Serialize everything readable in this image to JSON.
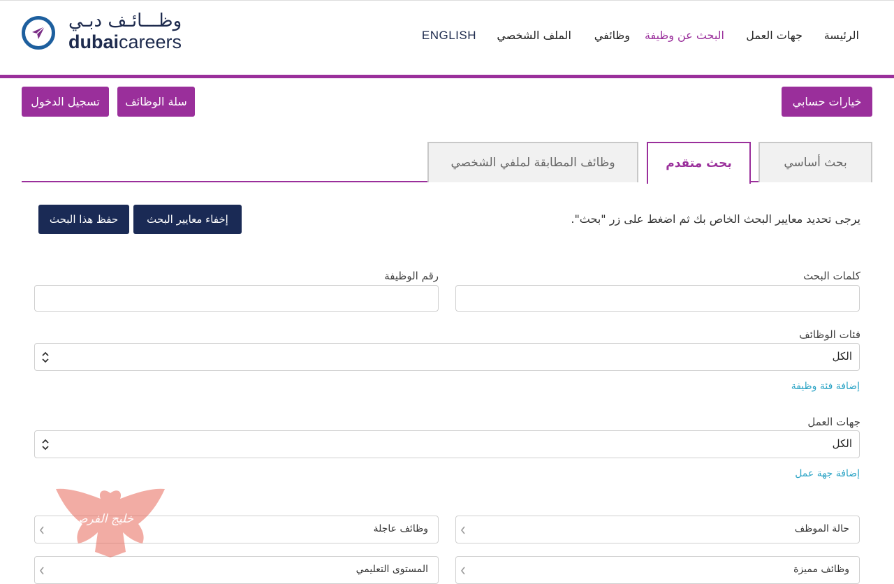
{
  "colors": {
    "accent": "#9a2f9b",
    "dark": "#1a2a55",
    "link": "#2aa3c5"
  },
  "logo": {
    "arabic": "وظـــائـف دبـي",
    "english_bold": "dubai",
    "english_regular": "careers"
  },
  "nav": {
    "home": "الرئيسة",
    "employers": "جهات العمل",
    "job_search": "البحث عن وظيفة",
    "my_jobs": "وظائفي",
    "profile": "الملف الشخصي",
    "language": "ENGLISH"
  },
  "account": {
    "options": "خيارات حسابي",
    "job_cart": "سلة الوظائف",
    "login": "تسجيل الدخول"
  },
  "tabs": {
    "basic": "بحث أساسي",
    "advanced": "بحث متقدم",
    "matching": "وظائف المطابقة لملفي الشخصي"
  },
  "search": {
    "hint": "يرجى تحديد معايير البحث الخاص بك ثم اضغط على زر \"بحث\".",
    "hide_criteria": "إخفاء معايير البحث",
    "save_search": "حفظ هذا البحث",
    "keywords_label": "كلمات البحث",
    "job_number_label": "رقم الوظيفة",
    "category_label": "فئات الوظائف",
    "category_value": "الكل",
    "add_category": "إضافة فئة وظيفة",
    "employers_label": "جهات العمل",
    "employers_value": "الكل",
    "add_employer": "إضافة جهة عمل"
  },
  "filters": {
    "employee_status": "حالة الموظف",
    "urgent_jobs": "وظائف عاجلة",
    "featured_jobs": "وظائف مميزة",
    "education_level": "المستوى التعليمي"
  },
  "watermark": {
    "text": "خليج الفرص"
  }
}
